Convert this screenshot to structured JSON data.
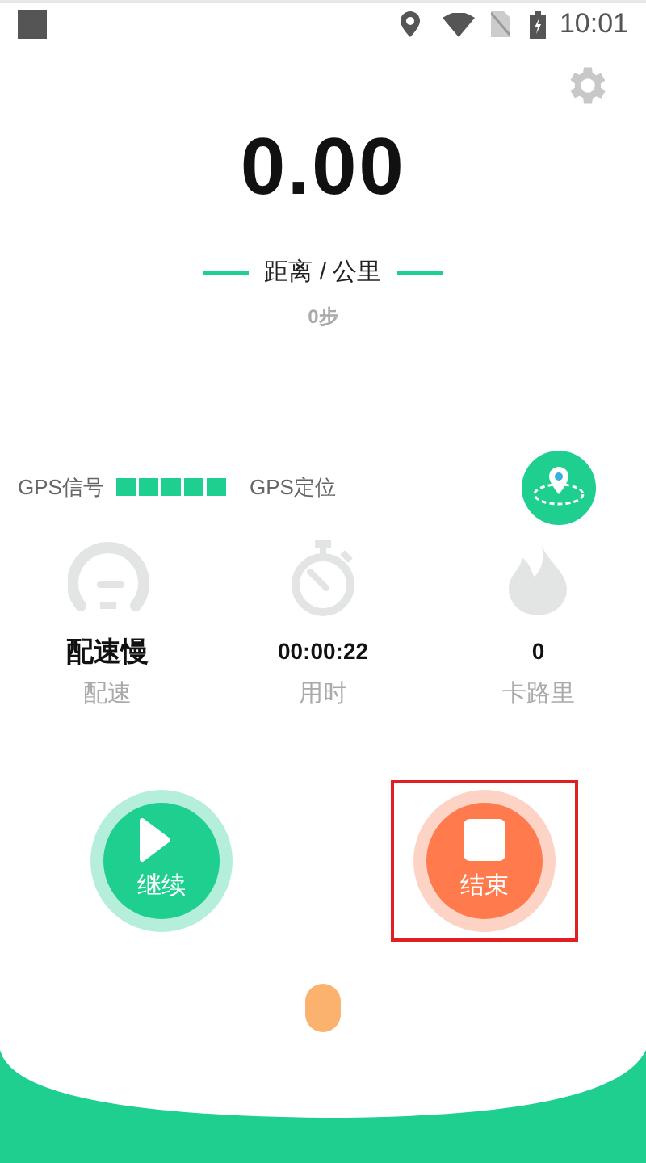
{
  "status_bar": {
    "time": "10:01"
  },
  "distance": {
    "value": "0.00",
    "unit_label": "距离 / 公里",
    "steps": "0步"
  },
  "gps": {
    "signal_label": "GPS信号",
    "locate_label": "GPS定位"
  },
  "stats": [
    {
      "kind": "pace",
      "value": "配速慢",
      "label": "配速"
    },
    {
      "kind": "time",
      "value": "00:00:22",
      "label": "用时"
    },
    {
      "kind": "calories",
      "value": "0",
      "label": "卡路里"
    }
  ],
  "buttons": [
    {
      "kind": "resume",
      "label": "继续",
      "highlighted": false
    },
    {
      "kind": "stop",
      "label": "结束",
      "highlighted": true
    }
  ]
}
